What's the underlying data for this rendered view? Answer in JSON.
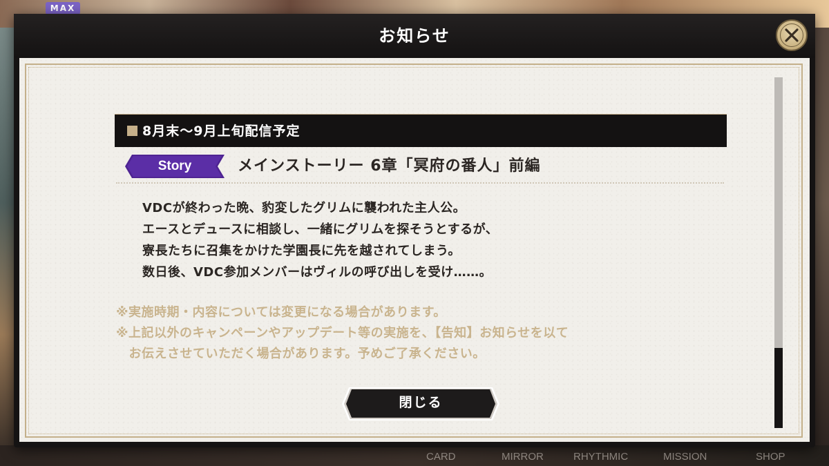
{
  "background": {
    "badge": "MAX",
    "bottom_nav": [
      "CARD",
      "MIRROR",
      "RHYTHMIC",
      "MISSION",
      "SHOP"
    ]
  },
  "modal": {
    "title": "お知らせ",
    "close_icon": "close-x-icon",
    "section_heading": "8月末〜9月上旬配信予定",
    "story": {
      "tag": "Story",
      "tag_color": "#5a2d9c",
      "title": "メインストーリー 6章「冥府の番人」前編"
    },
    "body": [
      "VDCが終わった晩、豹変したグリムに襲われた主人公。",
      "エースとデュースに相談し、一緒にグリムを探そうとするが、",
      "寮長たちに召集をかけた学園長に先を越されてしまう。",
      "数日後、VDC参加メンバーはヴィルの呼び出しを受け……。"
    ],
    "notes": [
      "※実施時期・内容については変更になる場合があります。",
      "※上記以外のキャンペーンやアップデート等の実施を、【告知】お知らせを以て",
      "　お伝えさせていただく場合があります。予めご了承ください。"
    ],
    "close_button": "閉じる",
    "accent_gold": "#c4b08a"
  }
}
